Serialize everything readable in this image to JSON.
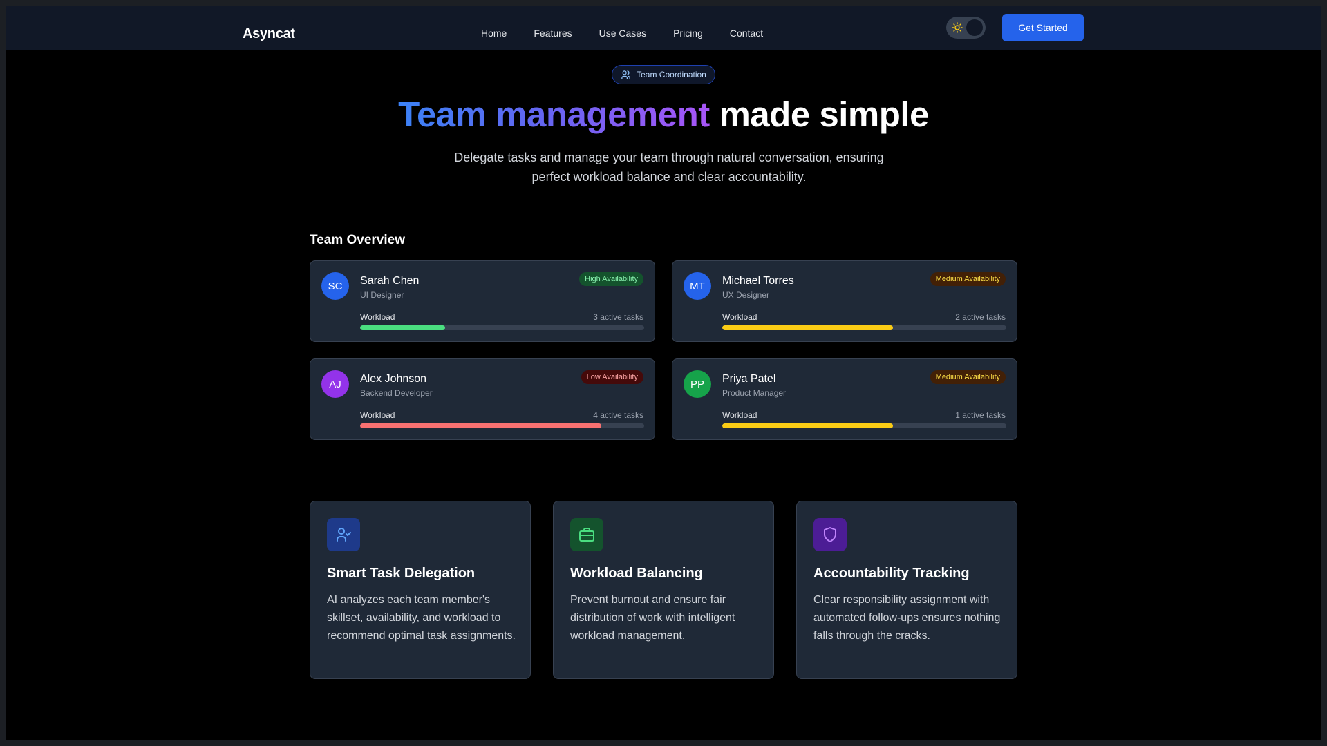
{
  "nav": {
    "logo": "Asyncat",
    "links": [
      "Home",
      "Features",
      "Use Cases",
      "Pricing",
      "Contact"
    ],
    "cta": "Get Started",
    "theme_toggle_icon": "sun-icon"
  },
  "hero": {
    "pill_icon": "users-icon",
    "pill": "Team Coordination",
    "title_gradient": "Team management",
    "title_rest": " made simple",
    "subtitle": "Delegate tasks and manage your team through natural conversation, ensuring perfect workload balance and clear accountability."
  },
  "team": {
    "title": "Team Overview",
    "members": [
      {
        "initials": "SC",
        "name": "Sarah Chen",
        "role": "UI Designer",
        "availability": "High Availability",
        "workload_label": "Workload",
        "tasks": "3 active tasks",
        "workload": 0.3,
        "avatar_color": "#2563eb",
        "bar_color": "#4ade80"
      },
      {
        "initials": "MT",
        "name": "Michael Torres",
        "role": "UX Designer",
        "availability": "Medium Availability",
        "workload_label": "Workload",
        "tasks": "2 active tasks",
        "workload": 0.6,
        "avatar_color": "#2563eb",
        "bar_color": "#facc15"
      },
      {
        "initials": "AJ",
        "name": "Alex Johnson",
        "role": "Backend Developer",
        "availability": "Low Availability",
        "workload_label": "Workload",
        "tasks": "4 active tasks",
        "workload": 0.85,
        "avatar_color": "#9333ea",
        "bar_color": "#f87171"
      },
      {
        "initials": "PP",
        "name": "Priya Patel",
        "role": "Product Manager",
        "availability": "Medium Availability",
        "workload_label": "Workload",
        "tasks": "1 active tasks",
        "workload": 0.6,
        "avatar_color": "#16a34a",
        "bar_color": "#facc15"
      }
    ]
  },
  "features": [
    {
      "icon": "user-check-icon",
      "icon_bg": "#1e3a8a",
      "icon_color": "#60a5fa",
      "title": "Smart Task Delegation",
      "description": "AI analyzes each team member's skillset, availability, and workload to recommend optimal task assignments."
    },
    {
      "icon": "briefcase-icon",
      "icon_bg": "#14532d",
      "icon_color": "#4ade80",
      "title": "Workload Balancing",
      "description": "Prevent burnout and ensure fair distribution of work with intelligent workload management."
    },
    {
      "icon": "shield-icon",
      "icon_bg": "#4c1d95",
      "icon_color": "#c084fc",
      "title": "Accountability Tracking",
      "description": "Clear responsibility assignment with automated follow-ups ensures nothing falls through the cracks."
    }
  ]
}
